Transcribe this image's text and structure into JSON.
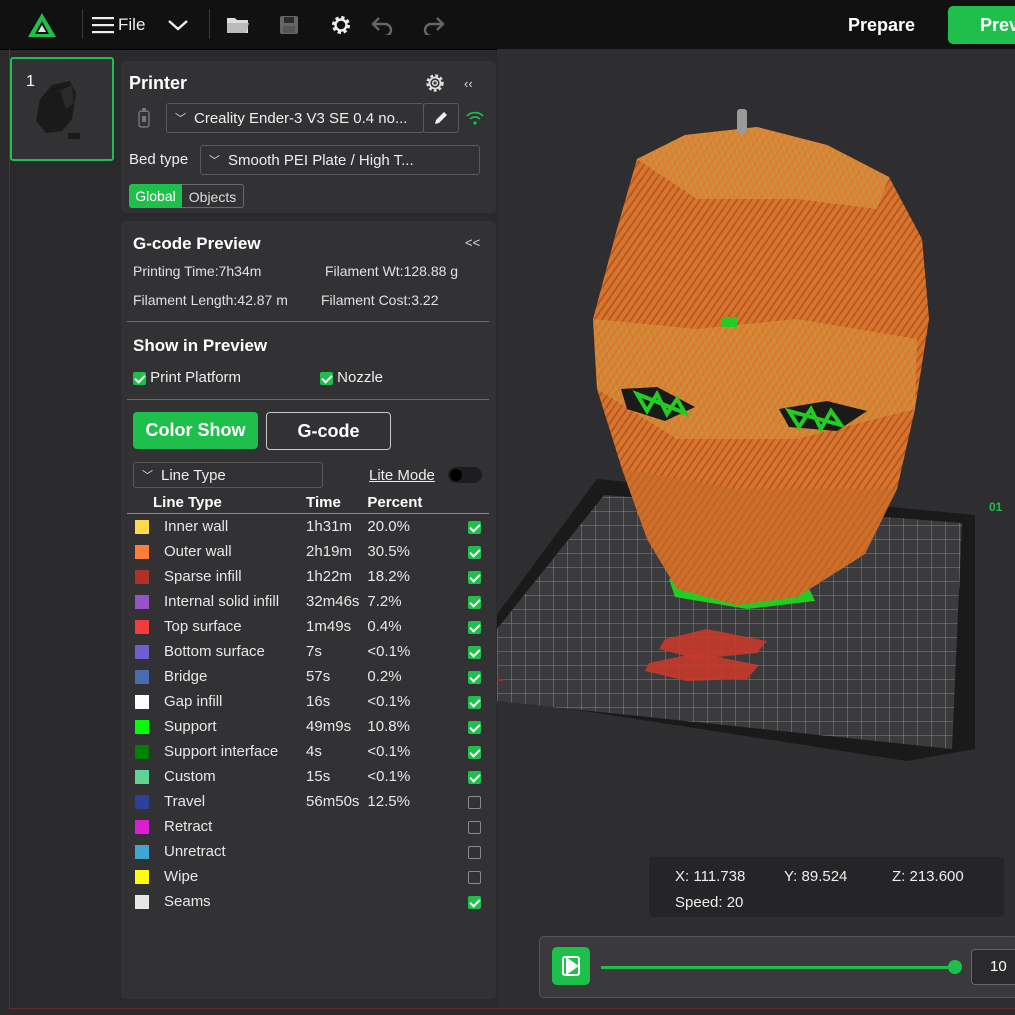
{
  "topbar": {
    "file_label": "File",
    "prepare_label": "Prepare",
    "preview_label": "Prev"
  },
  "plate": {
    "number": "1"
  },
  "printer": {
    "title": "Printer",
    "printer_name": "Creality Ender-3 V3 SE 0.4 no...",
    "bed_type_label": "Bed type",
    "bed_type_value": "Smooth PEI Plate / High T...",
    "tab_global": "Global",
    "tab_objects": "Objects"
  },
  "gcode": {
    "title": "G-code Preview",
    "collapse": "<<",
    "printing_time": "Printing Time:7h34m",
    "filament_wt": "Filament Wt:128.88 g",
    "filament_length": "Filament Length:42.87 m",
    "filament_cost": "Filament Cost:3.22"
  },
  "show_in_preview": {
    "title": "Show in Preview",
    "print_platform": "Print Platform",
    "nozzle": "Nozzle"
  },
  "view_buttons": {
    "color_show": "Color Show",
    "gcode": "G-code"
  },
  "line_type_select": {
    "value": "Line Type",
    "lite_mode": "Lite Mode"
  },
  "table": {
    "headers": [
      "Line Type",
      "Time",
      "Percent"
    ],
    "rows": [
      {
        "name": "Inner wall",
        "time": "1h31m",
        "percent": "20.0%",
        "color": "#ffd94a",
        "checked": true
      },
      {
        "name": "Outer wall",
        "time": "2h19m",
        "percent": "30.5%",
        "color": "#ff7d38",
        "checked": true
      },
      {
        "name": "Sparse infill",
        "time": "1h22m",
        "percent": "18.2%",
        "color": "#b03029",
        "checked": true
      },
      {
        "name": "Internal solid infill",
        "time": "32m46s",
        "percent": "7.2%",
        "color": "#9653c7",
        "checked": true
      },
      {
        "name": "Top surface",
        "time": "1m49s",
        "percent": "0.4%",
        "color": "#f03c3c",
        "checked": true
      },
      {
        "name": "Bottom surface",
        "time": "7s",
        "percent": "<0.1%",
        "color": "#6e5ed1",
        "checked": true
      },
      {
        "name": "Bridge",
        "time": "57s",
        "percent": "0.2%",
        "color": "#4a6bb0",
        "checked": true
      },
      {
        "name": "Gap infill",
        "time": "16s",
        "percent": "<0.1%",
        "color": "#ffffff",
        "checked": true
      },
      {
        "name": "Support",
        "time": "49m9s",
        "percent": "10.8%",
        "color": "#00ff00",
        "checked": true
      },
      {
        "name": "Support interface",
        "time": "4s",
        "percent": "<0.1%",
        "color": "#008000",
        "checked": true
      },
      {
        "name": "Custom",
        "time": "15s",
        "percent": "<0.1%",
        "color": "#5ed394",
        "checked": true
      },
      {
        "name": "Travel",
        "time": "56m50s",
        "percent": "12.5%",
        "color": "#2e3f99",
        "checked": false
      },
      {
        "name": "Retract",
        "time": "",
        "percent": "",
        "color": "#d91fd1",
        "checked": false
      },
      {
        "name": "Unretract",
        "time": "",
        "percent": "",
        "color": "#3ea6d1",
        "checked": false
      },
      {
        "name": "Wipe",
        "time": "",
        "percent": "",
        "color": "#ffff00",
        "checked": false
      },
      {
        "name": "Seams",
        "time": "",
        "percent": "",
        "color": "#e6e6e6",
        "checked": true
      }
    ]
  },
  "coords": {
    "x": "X: 111.738",
    "y": "Y: 89.524",
    "z": "Z: 213.600",
    "speed": "Speed: 20"
  },
  "player": {
    "layer": "10"
  },
  "bed_label": "01"
}
